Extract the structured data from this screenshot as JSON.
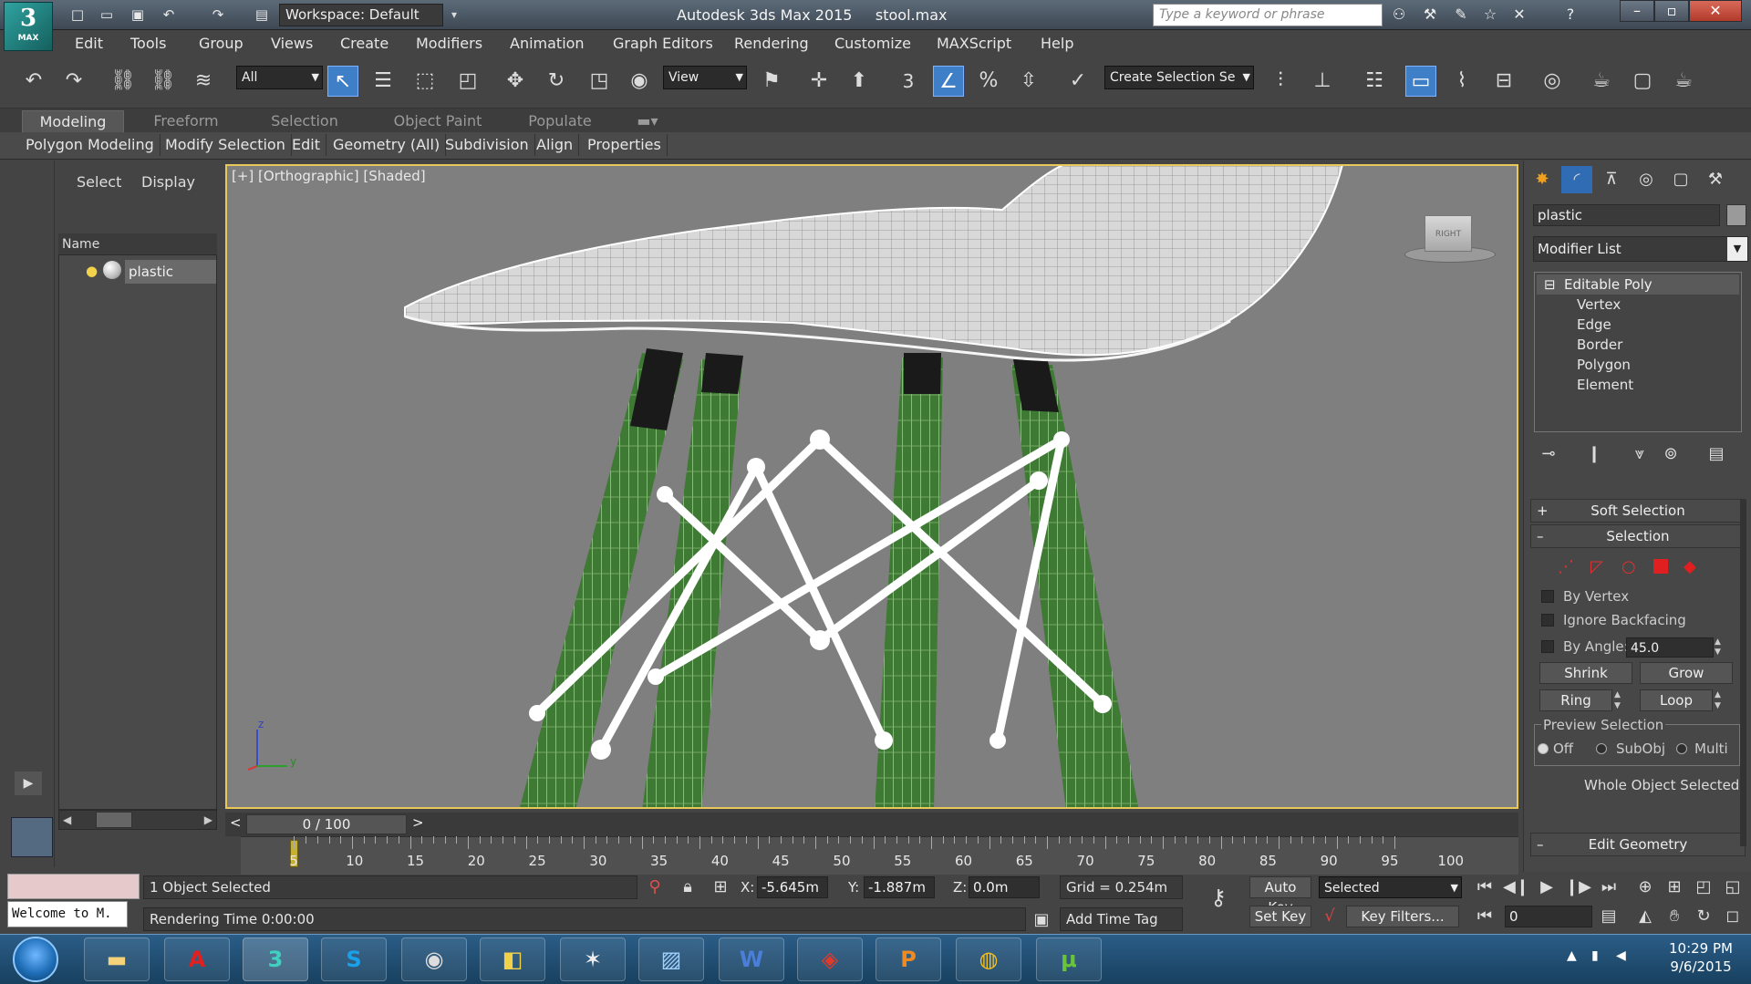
{
  "app": {
    "logo_text": "MAX",
    "workspace": "Workspace: Default",
    "title": "Autodesk 3ds Max 2015     stool.max",
    "search_placeholder": "Type a keyword or phrase"
  },
  "menu": [
    "Edit",
    "Tools",
    "Group",
    "Views",
    "Create",
    "Modifiers",
    "Animation",
    "Graph Editors",
    "Rendering",
    "Customize",
    "MAXScript",
    "Help"
  ],
  "toolbar": {
    "filter": "All",
    "refcoord": "View",
    "selset": "Create Selection Se",
    "snap_label": "3"
  },
  "ribbon": {
    "tabs": [
      "Modeling",
      "Freeform",
      "Selection",
      "Object Paint",
      "Populate"
    ],
    "groups": [
      "Polygon Modeling",
      "Modify Selection",
      "Edit",
      "Geometry (All)",
      "Subdivision",
      "Align",
      "Properties"
    ]
  },
  "scene": {
    "tabs": [
      "Select",
      "Display"
    ],
    "col_header": "Name",
    "items": [
      "plastic"
    ]
  },
  "viewport": {
    "label": "[+] [Orthographic] [Shaded]",
    "viewcube": "RIGHT",
    "axis_z": "z",
    "axis_y": "y"
  },
  "timeline": {
    "frame": "0 / 100",
    "prev": "<",
    "next": ">",
    "ticks": [
      "5",
      "10",
      "15",
      "20",
      "25",
      "30",
      "35",
      "40",
      "45",
      "50",
      "55",
      "60",
      "65",
      "70",
      "75",
      "80",
      "85",
      "90",
      "95",
      "100"
    ]
  },
  "status": {
    "selected": "1 Object Selected",
    "rendering": "Rendering Time  0:00:00",
    "welcome": "Welcome to M.",
    "x_label": "X:",
    "x": "-5.645m",
    "y_label": "Y:",
    "y": "-1.887m",
    "z_label": "Z:",
    "z": "0.0m",
    "grid": "Grid = 0.254m",
    "add_time_tag": "Add Time Tag",
    "auto_key": "Auto Key",
    "set_key": "Set Key",
    "key_mode": "Selected",
    "key_filters": "Key Filters...",
    "frame_num": "0"
  },
  "cmd": {
    "object_name": "plastic",
    "modifier_list": "Modifier List",
    "stack_root": "Editable Poly",
    "subobjects": [
      "Vertex",
      "Edge",
      "Border",
      "Polygon",
      "Element"
    ],
    "soft_selection": "Soft Selection",
    "selection": "Selection",
    "by_vertex": "By Vertex",
    "ignore_backfacing": "Ignore Backfacing",
    "by_angle": "By Angle:",
    "angle": "45.0",
    "shrink": "Shrink",
    "grow": "Grow",
    "ring": "Ring",
    "loop": "Loop",
    "preview_selection": "Preview Selection",
    "off": "Off",
    "subobj": "SubObj",
    "multi": "Multi",
    "whole_object": "Whole Object Selected",
    "edit_geometry": "Edit Geometry"
  },
  "clock": {
    "time": "10:29 PM",
    "date": "9/6/2015"
  },
  "colors": {
    "accent": "#3f7fc8",
    "viewport_border": "#e9c85a",
    "leg_green": "#3f7a34",
    "viewport_bg": "#7f7f7f"
  }
}
